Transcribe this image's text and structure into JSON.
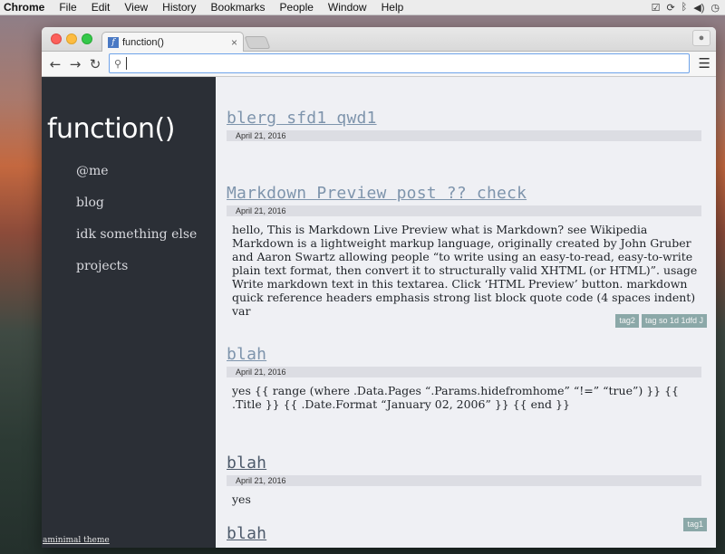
{
  "menubar": {
    "app": "Chrome",
    "items": [
      "File",
      "Edit",
      "View",
      "History",
      "Bookmarks",
      "People",
      "Window",
      "Help"
    ],
    "status_icons": [
      "check-circle-icon",
      "sync-icon",
      "bluetooth-icon",
      "volume-icon",
      "time-machine-icon"
    ]
  },
  "browser": {
    "tab_title": "function()",
    "tab_close": "×",
    "address_value": "",
    "profile_icon": "person-icon"
  },
  "site": {
    "title": "function()",
    "nav": [
      "@me",
      "blog",
      "idk something else",
      "projects"
    ],
    "theme_credit": "aminimal theme"
  },
  "posts": [
    {
      "title": "blerg sfd1 qwd1",
      "date": "April 21, 2016",
      "body": "",
      "tags": []
    },
    {
      "title": "Markdown Preview post ?? check",
      "date": "April 21, 2016",
      "body": "hello, This is Markdown Live Preview what is Markdown? see Wikipedia Markdown is a lightweight markup language, originally created by John Gruber and Aaron Swartz allowing people “to write using an easy-to-read, easy-to-write plain text format, then convert it to structurally valid XHTML (or HTML)”. usage Write markdown text in this textarea. Click ‘HTML Preview’ button. markdown quick reference headers emphasis strong list block quote code (4 spaces indent) var",
      "tags": [
        "tag2",
        "tag so 1d 1dfd J"
      ]
    },
    {
      "title": "blah",
      "date": "April 21, 2016",
      "body": "yes {{ range (where .Data.Pages “.Params.hidefromhome” “!=” “true”) }} {{ .Title }} {{ .Date.Format “January 02, 2006” }} {{ end }}",
      "tags": []
    },
    {
      "title": "blah",
      "date": "April 21, 2016",
      "body": "yes",
      "tags": [
        "tag1"
      ]
    },
    {
      "title": "blah",
      "date": "",
      "body": "",
      "tags": []
    }
  ]
}
